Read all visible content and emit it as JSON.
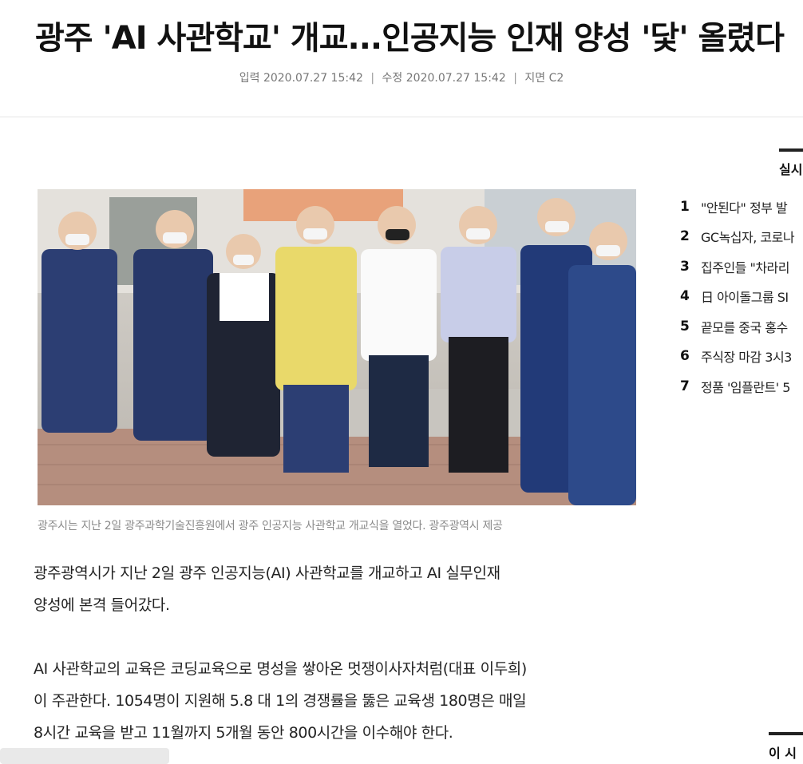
{
  "article": {
    "headline": "광주 'AI 사관학교' 개교...인공지능 인재 양성 '닻' 올렸다",
    "meta": {
      "input_label": "입력",
      "input_time": "2020.07.27 15:42",
      "edit_label": "수정",
      "edit_time": "2020.07.27 15:42",
      "page_label": "지면",
      "page_value": "C2"
    },
    "photo_caption": "광주시는 지난 2일 광주과학기술진흥원에서 광주 인공지능 사관학교 개교식을 열었다. 광주광역시 제공",
    "paragraphs": [
      {
        "lines": [
          "광주광역시가 지난 2일 광주 인공지능(AI) 사관학교를 개교하고 AI 실무인재",
          "양성에 본격 들어갔다."
        ]
      },
      {
        "lines": [
          "AI 사관학교의 교육은 코딩교육으로 명성을 쌓아온 멋쟁이사자처럼(대표 이두희)",
          "이 주관한다. 1054명이 지원해 5.8 대 1의 경쟁률을 뚫은 교육생 180명은 매일",
          "8시간 교육을 받고 11월까지 5개월 동안 800시간을 이수해야 한다."
        ]
      }
    ]
  },
  "sidebar": {
    "ranking_title": "실시",
    "ranking": [
      {
        "rank": "1",
        "title": "\"안된다\" 정부 발"
      },
      {
        "rank": "2",
        "title": "GC녹십자, 코로나"
      },
      {
        "rank": "3",
        "title": "집주인들 \"차라리"
      },
      {
        "rank": "4",
        "title": "日 아이돌그룹 SI"
      },
      {
        "rank": "5",
        "title": "끝모를 중국 홍수"
      },
      {
        "rank": "6",
        "title": "주식장 마감 3시3"
      },
      {
        "rank": "7",
        "title": "정품 '임플란트' 5"
      }
    ],
    "section2_title": "이 시"
  },
  "colors": {
    "text": "#222222",
    "meta": "#777777",
    "caption": "#8a8a8a",
    "divider": "#e5e5e5"
  }
}
